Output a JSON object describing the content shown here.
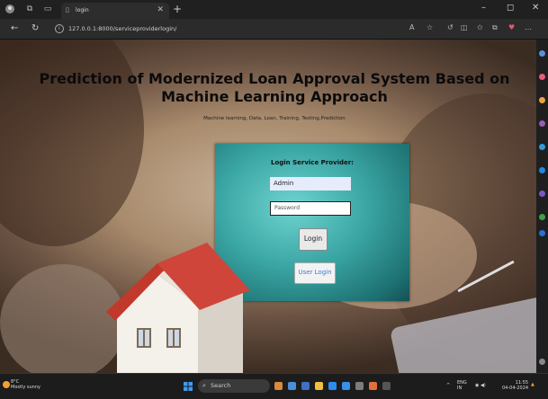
{
  "browser": {
    "tab_title": "login",
    "tab_close": "✕",
    "new_tab": "+",
    "url": "127.0.0.1:8000/serviceproviderlogin/",
    "win_minimize": "–",
    "win_maximize": "◻",
    "win_close": "✕"
  },
  "page": {
    "title": "Prediction of Modernized Loan Approval System Based on Machine Learning Approach",
    "subtitle": "Machine learning, Data, Loan, Training, Testing,Prediction",
    "panel_title": "Login Service Provider:",
    "username_value": "Admin",
    "password_placeholder": "Password",
    "login_button": "Login",
    "user_login_button": "User Login"
  },
  "taskbar": {
    "temperature": "8°C",
    "weather_text": "Mostly sunny",
    "search_label": "Search",
    "lang": "ENG",
    "lang_region": "IN",
    "time": "11:55",
    "date": "04-04-2024"
  },
  "colors": {
    "panel_teal": "#3aa6a4",
    "user_login_text": "#3a7bd5"
  }
}
